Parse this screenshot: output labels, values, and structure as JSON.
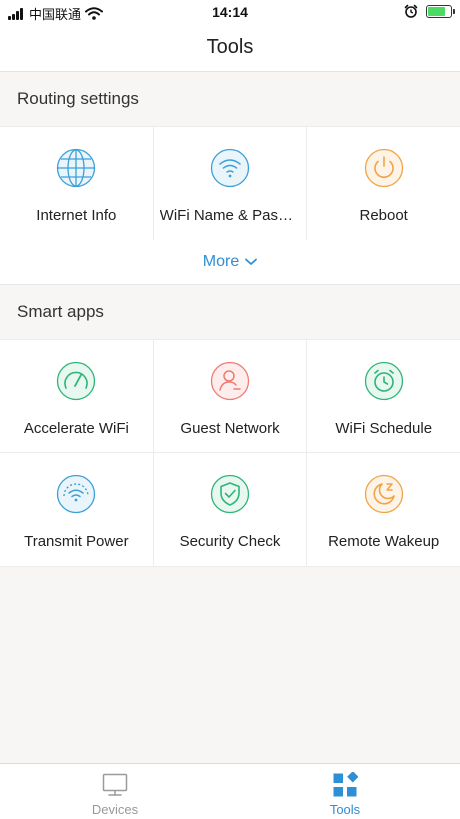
{
  "status_bar": {
    "carrier": "中国联通",
    "time": "14:14",
    "battery_level": 0.7
  },
  "header": {
    "title": "Tools"
  },
  "routing": {
    "title": "Routing settings",
    "items": [
      {
        "label": "Internet Info",
        "icon": "globe-icon",
        "color": "#3d9fd8"
      },
      {
        "label": "WiFi Name & Password",
        "icon": "wifi-icon",
        "color": "#3d9fd8"
      },
      {
        "label": "Reboot",
        "icon": "power-icon",
        "color": "#f0a446"
      }
    ],
    "more_label": "More"
  },
  "smart_apps": {
    "title": "Smart apps",
    "items": [
      {
        "label": "Accelerate WiFi",
        "icon": "speedometer-icon",
        "color": "#2fb577"
      },
      {
        "label": "Guest Network",
        "icon": "guest-user-icon",
        "color": "#ef7b73"
      },
      {
        "label": "WiFi Schedule",
        "icon": "alarm-clock-icon",
        "color": "#2fb577"
      },
      {
        "label": "Transmit Power",
        "icon": "transmit-power-icon",
        "color": "#3d9fd8"
      },
      {
        "label": "Security Check",
        "icon": "shield-check-icon",
        "color": "#2fb577"
      },
      {
        "label": "Remote Wakeup",
        "icon": "moon-icon",
        "color": "#f0a446"
      }
    ]
  },
  "tab_bar": {
    "tabs": [
      {
        "label": "Devices",
        "icon": "monitor-icon",
        "active": false
      },
      {
        "label": "Tools",
        "icon": "tools-grid-icon",
        "active": true
      }
    ]
  },
  "colors": {
    "accent": "#2d8fd5",
    "background": "#f7f6f4"
  }
}
